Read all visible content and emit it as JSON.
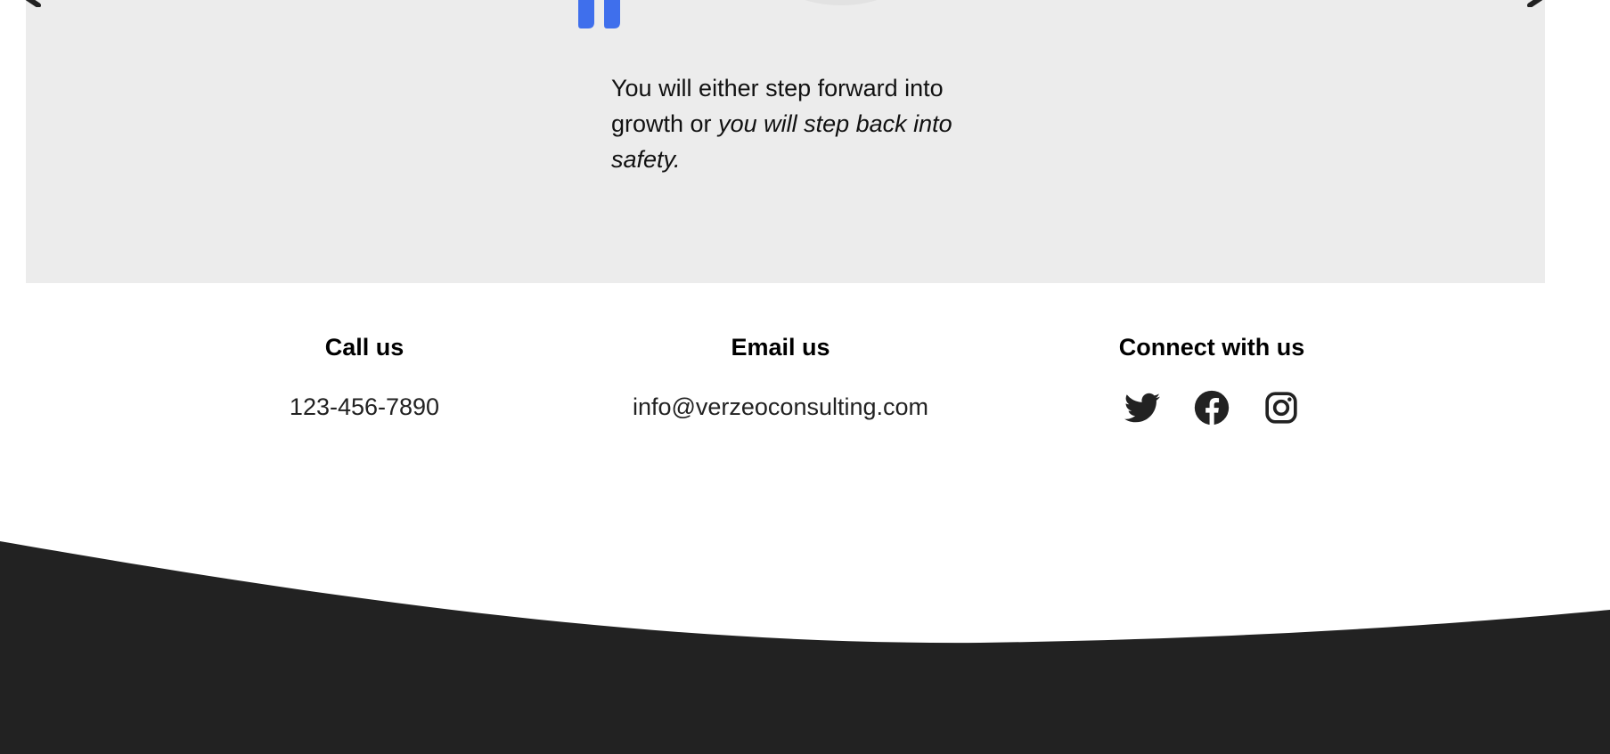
{
  "colors": {
    "accent": "#3f6fec",
    "testimonial_bg": "#ececec",
    "footer_bg": "#222222",
    "text": "#111111"
  },
  "testimonial": {
    "quote_plain": "You will either step forward into growth or ",
    "quote_italic": "you will step back into safety.",
    "icons": [
      "quote-mark-icon",
      "chevron-left-icon",
      "chevron-right-icon"
    ]
  },
  "contact": {
    "call": {
      "heading": "Call us",
      "value": "123-456-7890"
    },
    "email": {
      "heading": "Email us",
      "value": "info@verzeoconsulting.com"
    },
    "connect": {
      "heading": "Connect with us",
      "icons": [
        "twitter-icon",
        "facebook-icon",
        "instagram-icon"
      ]
    }
  }
}
